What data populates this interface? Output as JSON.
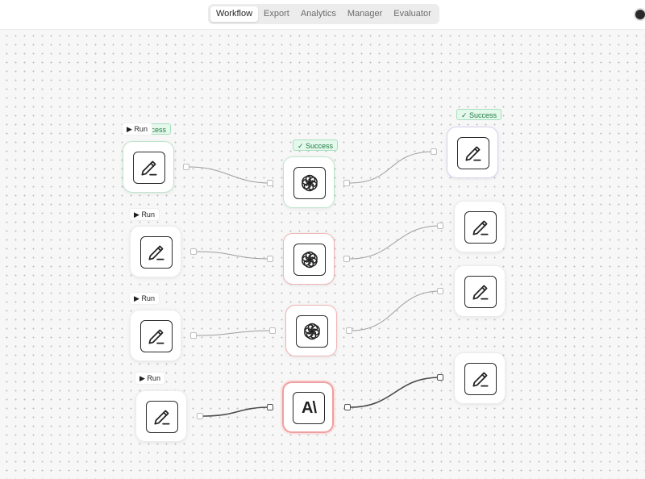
{
  "tabs": [
    {
      "label": "Workflow",
      "active": true
    },
    {
      "label": "Export",
      "active": false
    },
    {
      "label": "Analytics",
      "active": false
    },
    {
      "label": "Manager",
      "active": false
    },
    {
      "label": "Evaluator",
      "active": false
    }
  ],
  "labels": {
    "run": "Run",
    "success": "✓ Success",
    "success_partial": "uccess"
  },
  "icons": {
    "input_node": "pencil-edit-icon",
    "openai_node": "openai-logo-icon",
    "anthropic_node": "anthropic-logo-icon",
    "output_node": "pencil-edit-icon",
    "run_button": "play-icon"
  },
  "anthropic_mark": "A\\",
  "colors": {
    "success_bg": "#e4f8eb",
    "success_text": "#1e7a43",
    "error_border": "#f0b4b4",
    "success_border": "#bfe6cc",
    "edge": "#9e9e9e",
    "edge_active": "#4a4a4a"
  }
}
